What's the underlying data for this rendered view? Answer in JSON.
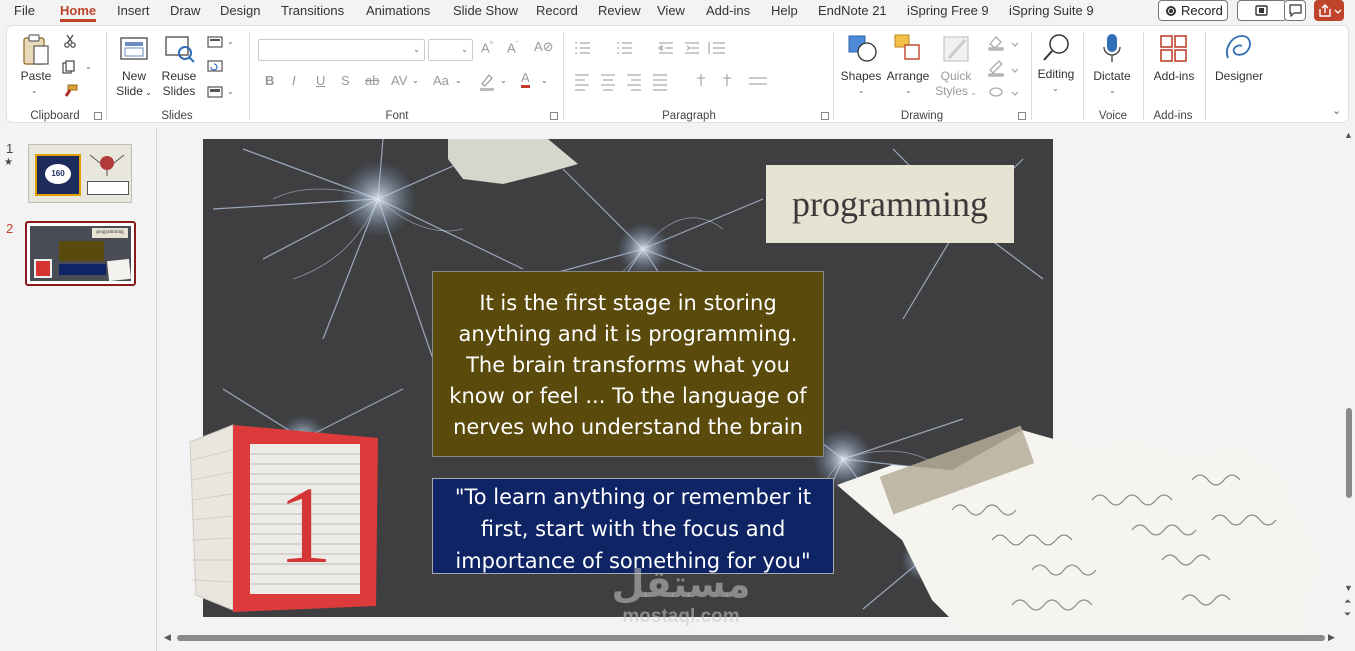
{
  "menu": {
    "tabs": [
      "File",
      "Home",
      "Insert",
      "Draw",
      "Design",
      "Transitions",
      "Animations",
      "Slide Show",
      "Record",
      "Review",
      "View",
      "Add-ins",
      "Help",
      "EndNote 21",
      "iSpring Free 9",
      "iSpring Suite 9"
    ],
    "active": "Home",
    "record_label": "Record"
  },
  "ribbon": {
    "clipboard": {
      "paste": "Paste",
      "label": "Clipboard"
    },
    "slides": {
      "new_slide_1": "New",
      "new_slide_2": "Slide",
      "reuse_1": "Reuse",
      "reuse_2": "Slides",
      "label": "Slides"
    },
    "font": {
      "label": "Font",
      "bold": "B",
      "italic": "I",
      "underline": "U",
      "shadow": "S",
      "strike": "ab",
      "spacing": "AV",
      "case": "Aa",
      "font_color": "A"
    },
    "paragraph": {
      "label": "Paragraph"
    },
    "drawing": {
      "shapes": "Shapes",
      "arrange": "Arrange",
      "quick_1": "Quick",
      "quick_2": "Styles",
      "label": "Drawing"
    },
    "editing": {
      "label": "Editing"
    },
    "voice": {
      "dictate": "Dictate",
      "label": "Voice"
    },
    "addins": {
      "button": "Add-ins",
      "label": "Add-ins"
    },
    "designer": {
      "label": "Designer"
    }
  },
  "thumbnails": [
    {
      "number": "1",
      "star": "★",
      "badge": "160"
    },
    {
      "number": "2",
      "title": "programming"
    }
  ],
  "slide": {
    "title": "programming",
    "body_lines": [
      "It is the first stage in storing",
      "anything and it is programming.",
      "The brain transforms what you",
      "know or feel ... To the language of",
      "nerves who understand the brain"
    ],
    "quote_lines": [
      "\"To learn anything or remember it",
      "first, start with the focus and",
      "importance of something for you\""
    ],
    "block_number": "1"
  },
  "watermark": {
    "arabic": "مستقل",
    "latin": "mostaql.com"
  },
  "colors": {
    "accent": "#c0432c",
    "body_box": "#5a4a0c",
    "quote_box": "#0e2465",
    "title_box": "#e6e3d2"
  }
}
